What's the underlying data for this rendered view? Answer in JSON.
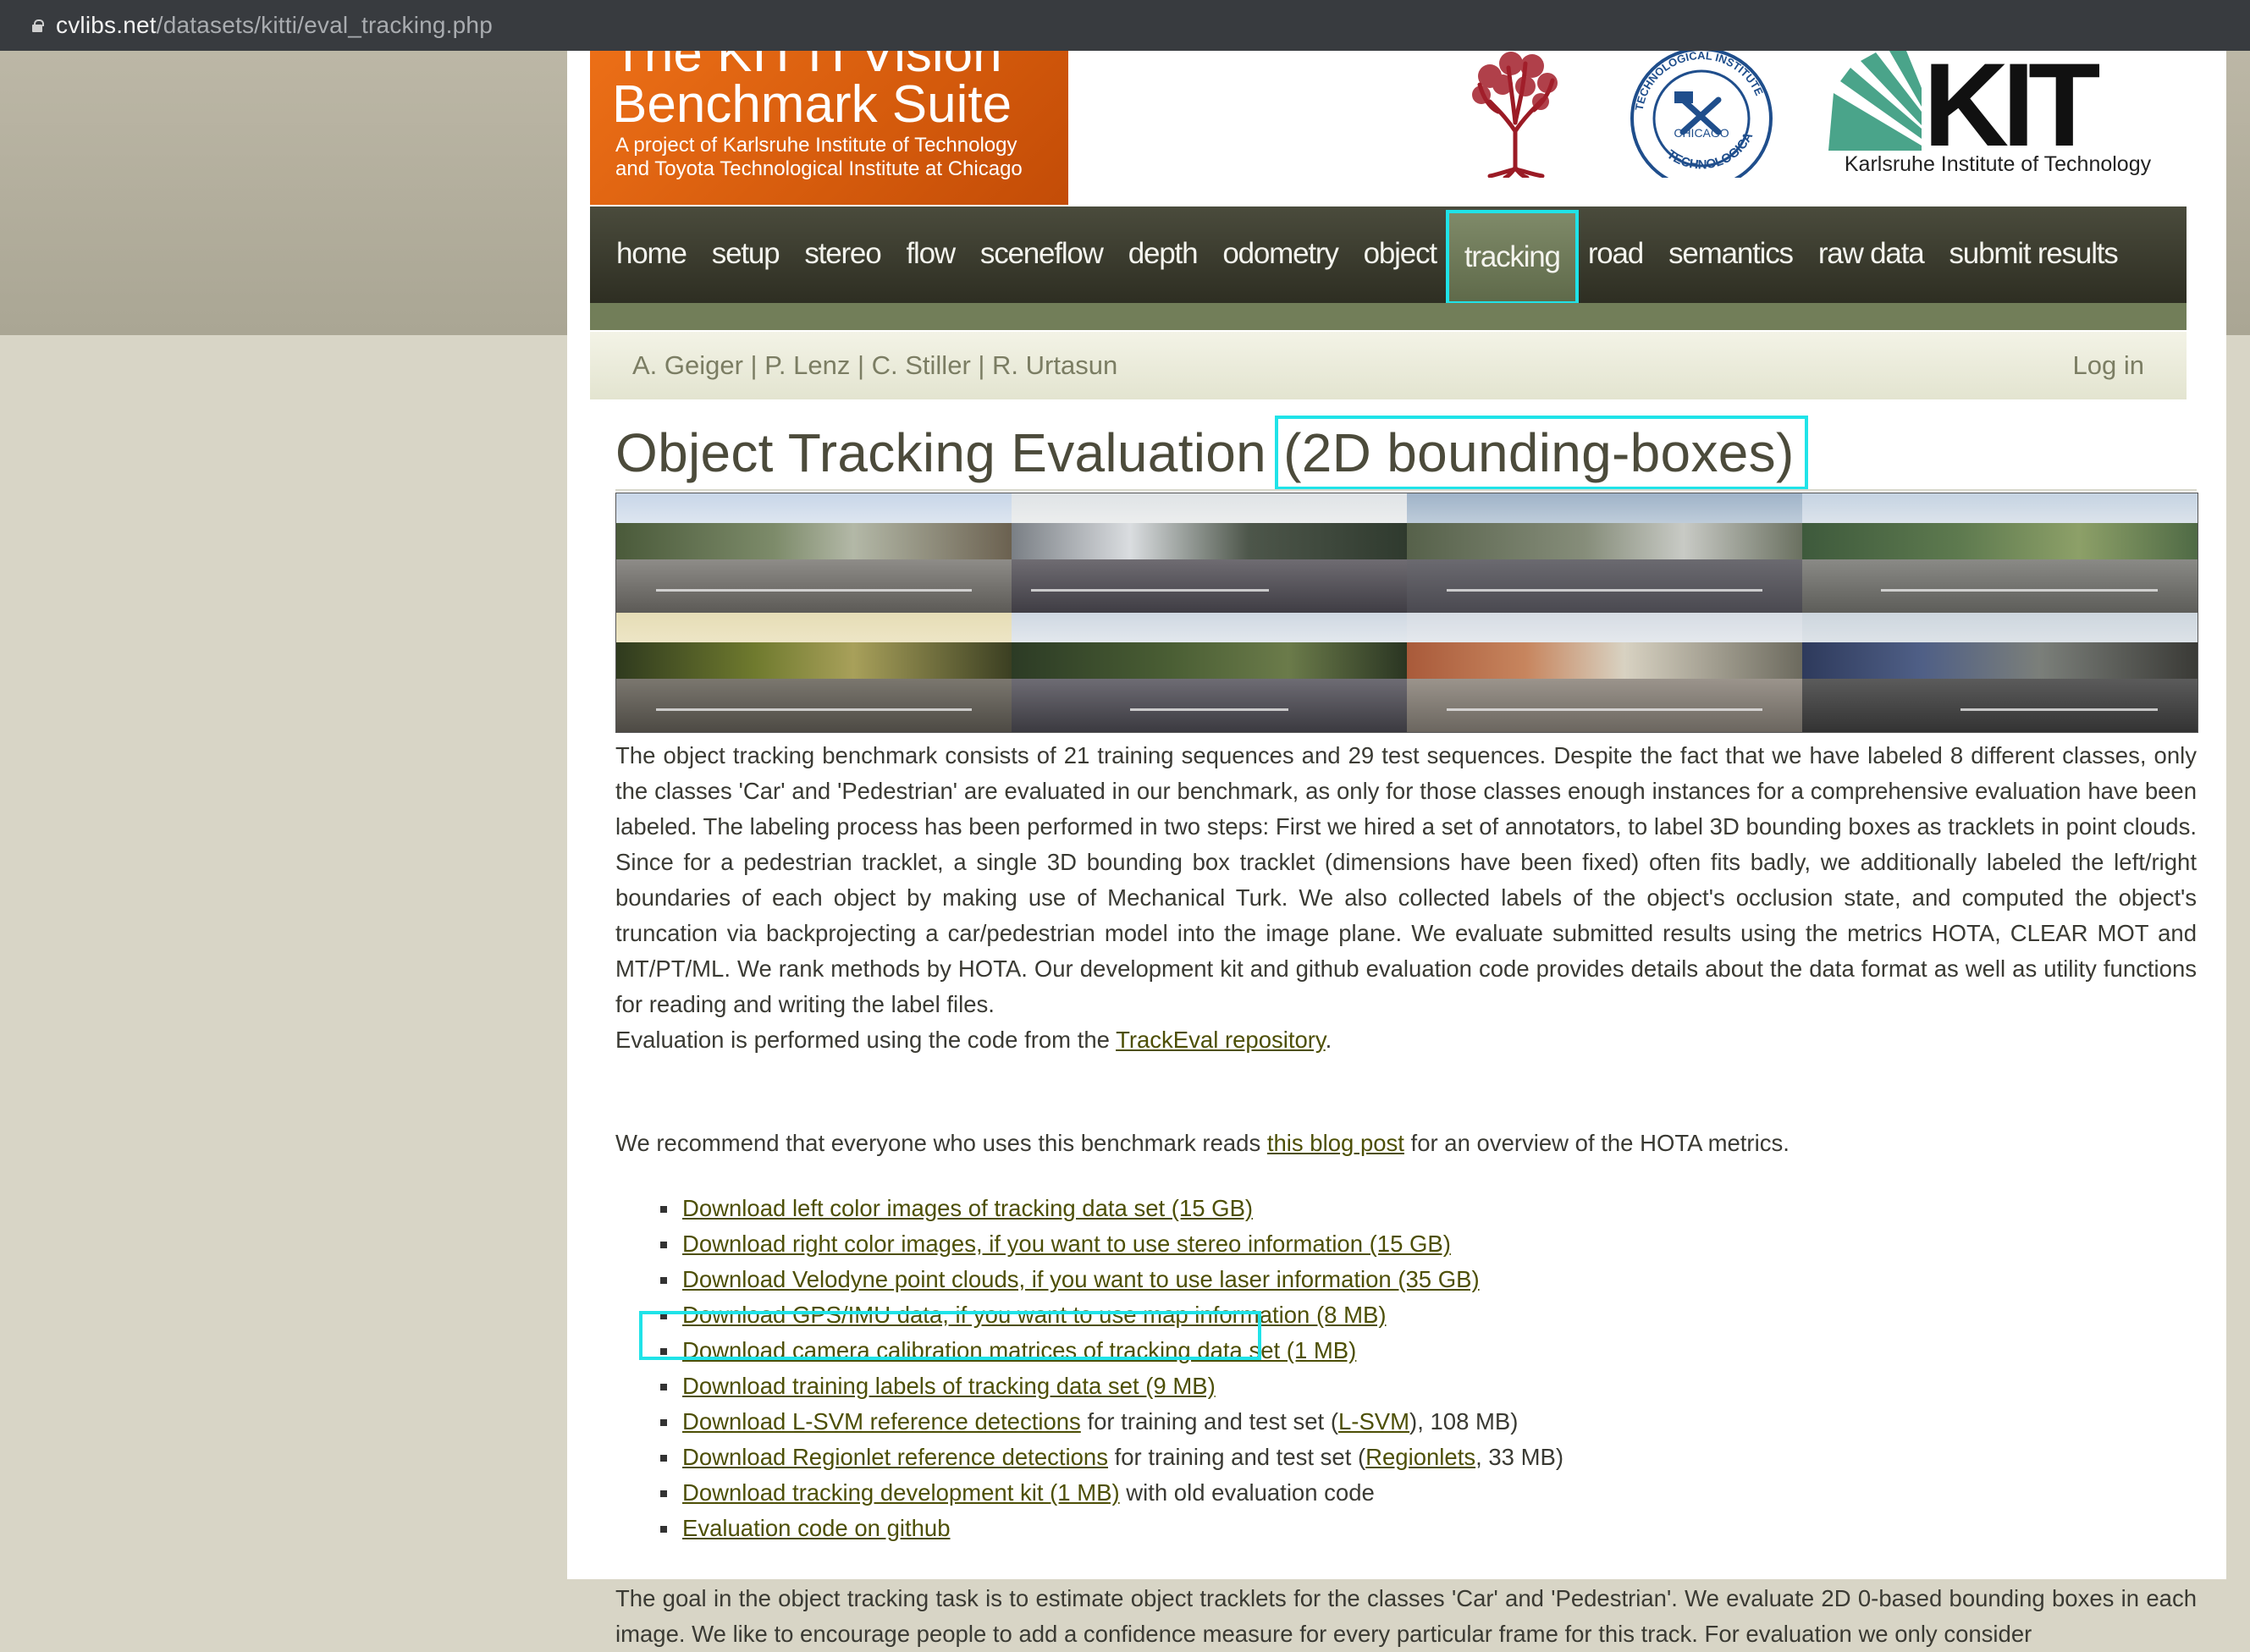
{
  "browser": {
    "url_domain": "cvlibs.net",
    "url_path": "/datasets/kitti/eval_tracking.php"
  },
  "header": {
    "title_line1": "The KITTI Vision",
    "title_line2": "Benchmark Suite",
    "subtitle_line1": "A project of Karlsruhe Institute of Technology",
    "subtitle_line2": "and Toyota Technological Institute at Chicago",
    "tti_logo_text_top": "TECHNOLOGICAL INSTITUTE",
    "tti_logo_text_center": "CHICAGO",
    "kit_logo_text": "KIT",
    "kit_caption": "Karlsruhe Institute of Technology"
  },
  "nav": {
    "items": [
      {
        "label": "home"
      },
      {
        "label": "setup"
      },
      {
        "label": "stereo"
      },
      {
        "label": "flow"
      },
      {
        "label": "sceneflow"
      },
      {
        "label": "depth"
      },
      {
        "label": "odometry"
      },
      {
        "label": "object"
      },
      {
        "label": "tracking"
      },
      {
        "label": "road"
      },
      {
        "label": "semantics"
      },
      {
        "label": "raw data"
      },
      {
        "label": "submit results"
      }
    ],
    "active": "tracking"
  },
  "authors": {
    "text": "A. Geiger | P. Lenz | C. Stiller | R. Urtasun",
    "login": "Log in"
  },
  "page": {
    "title_main": "Object Tracking Evaluation ",
    "title_highlight": "(2D bounding-boxes)",
    "paragraph1": "The object tracking benchmark consists of 21 training sequences and 29 test sequences. Despite the fact that we have labeled 8 different classes, only the classes 'Car' and 'Pedestrian' are evaluated in our benchmark, as only for those classes enough instances for a comprehensive evaluation have been labeled. The labeling process has been performed in two steps: First we hired a set of annotators, to label 3D bounding boxes as tracklets in point clouds. Since for a pedestrian tracklet, a single 3D bounding box tracklet (dimensions have been fixed) often fits badly, we additionally labeled the left/right boundaries of each object by making use of Mechanical Turk. We also collected labels of the object's occlusion state, and computed the object's truncation via backprojecting a car/pedestrian model into the image plane. We evaluate submitted results using the metrics HOTA, CLEAR MOT and MT/PT/ML. We rank methods by HOTA. Our development kit and github evaluation code provides details about the data format as well as utility functions for reading and writing the label files.",
    "eval_prefix": "Evaluation is performed using the code from the ",
    "eval_link": "TrackEval repository",
    "eval_suffix": ".",
    "rec_prefix": "We recommend that everyone who uses this benchmark reads ",
    "rec_link": "this blog post",
    "rec_suffix": " for an overview of the HOTA metrics.",
    "goal_text": "The goal in the object tracking task is to estimate object tracklets for the classes 'Car' and 'Pedestrian'. We evaluate 2D 0-based bounding boxes in each image. We like to encourage people to add a confidence measure for every particular frame for this track. For evaluation we only consider"
  },
  "downloads": [
    {
      "link": "Download left color images of tracking data set (15 GB)",
      "suffix": ""
    },
    {
      "link": "Download right color images, if you want to use stereo information (15 GB)",
      "suffix": ""
    },
    {
      "link": "Download Velodyne point clouds, if you want to use laser information (35 GB)",
      "suffix": ""
    },
    {
      "link": "Download GPS/IMU data, if you want to use map information (8 MB)",
      "suffix": ""
    },
    {
      "link": "Download camera calibration matrices of tracking data set (1 MB)",
      "suffix": ""
    },
    {
      "link": "Download training labels of tracking data set (9 MB)",
      "suffix": ""
    },
    {
      "link": "Download L-SVM reference detections",
      "suffix_pre": " for training and test set (",
      "suffix_link": "L-SVM",
      "suffix_post": "), 108 MB)"
    },
    {
      "link": "Download Regionlet reference detections",
      "suffix_pre": " for training and test set (",
      "suffix_link": "Regionlets",
      "suffix_post": ", 33 MB)"
    },
    {
      "link": "Download tracking development kit (1 MB)",
      "suffix": " with old evaluation code"
    },
    {
      "link": "Evaluation code on github",
      "suffix": ""
    }
  ],
  "colors": {
    "highlight": "#1fe3e8",
    "nav_bg": "#2f2f24",
    "banner": "#e0640f",
    "link": "#4d4f06"
  }
}
